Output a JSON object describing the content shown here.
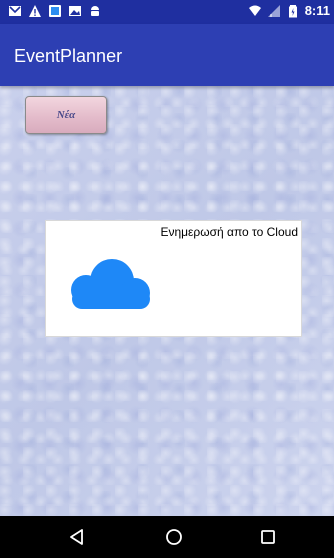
{
  "status_bar": {
    "time": "8:11",
    "left_icons": [
      "gmail-icon",
      "warning-icon",
      "app-icon",
      "photo-icon",
      "android-icon"
    ],
    "right_icons": [
      "wifi-icon",
      "signal-icon",
      "battery-icon"
    ]
  },
  "app_bar": {
    "title": "EventPlanner"
  },
  "content": {
    "new_button_label": "Νέα",
    "cloud_update_label": "Ενημερωσή απο το Cloud",
    "cloud_icon": "cloud-icon"
  },
  "nav_bar": {
    "buttons": [
      "back-icon",
      "home-icon",
      "recents-icon"
    ]
  },
  "colors": {
    "status_bar": "#1f2fa0",
    "app_bar": "#2d3fb3",
    "cloud_blue": "#1e88f7",
    "button_pink": "#e4bccb",
    "background": "#c8d0ea"
  }
}
